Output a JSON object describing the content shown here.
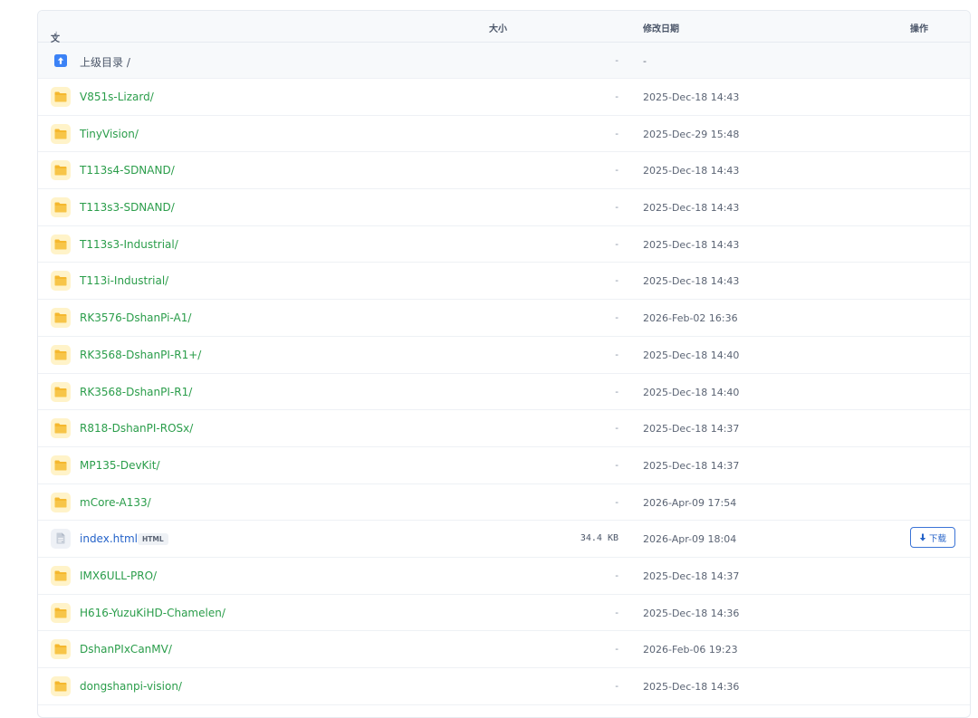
{
  "header": {
    "name": "文件名",
    "sort_icon": "↓",
    "size": "大小",
    "modified": "修改日期",
    "action": "操作"
  },
  "parent": {
    "label": "上级目录 /",
    "size": "-",
    "date": "-",
    "icon": "arrow-up-icon",
    "color": "#3b82f6"
  },
  "rows": [
    {
      "name": "V851s-Lizard/",
      "size": "-",
      "date": "2025-Dec-18 14:43",
      "type": "folder"
    },
    {
      "name": "TinyVision/",
      "size": "-",
      "date": "2025-Dec-29 15:48",
      "type": "folder"
    },
    {
      "name": "T113s4-SDNAND/",
      "size": "-",
      "date": "2025-Dec-18 14:43",
      "type": "folder"
    },
    {
      "name": "T113s3-SDNAND/",
      "size": "-",
      "date": "2025-Dec-18 14:43",
      "type": "folder"
    },
    {
      "name": "T113s3-Industrial/",
      "size": "-",
      "date": "2025-Dec-18 14:43",
      "type": "folder"
    },
    {
      "name": "T113i-Industrial/",
      "size": "-",
      "date": "2025-Dec-18 14:43",
      "type": "folder"
    },
    {
      "name": "RK3576-DshanPi-A1/",
      "size": "-",
      "date": "2026-Feb-02 16:36",
      "type": "folder"
    },
    {
      "name": "RK3568-DshanPI-R1+/",
      "size": "-",
      "date": "2025-Dec-18 14:40",
      "type": "folder"
    },
    {
      "name": "RK3568-DshanPI-R1/",
      "size": "-",
      "date": "2025-Dec-18 14:40",
      "type": "folder"
    },
    {
      "name": "R818-DshanPI-ROSx/",
      "size": "-",
      "date": "2025-Dec-18 14:37",
      "type": "folder"
    },
    {
      "name": "MP135-DevKit/",
      "size": "-",
      "date": "2025-Dec-18 14:37",
      "type": "folder"
    },
    {
      "name": "mCore-A133/",
      "size": "-",
      "date": "2026-Apr-09 17:54",
      "type": "folder"
    },
    {
      "name": "index.html",
      "badge": "HTML",
      "size": "34.4 KB",
      "date": "2026-Apr-09 18:04",
      "type": "file",
      "download_label": "下载"
    },
    {
      "name": "IMX6ULL-PRO/",
      "size": "-",
      "date": "2025-Dec-18 14:37",
      "type": "folder"
    },
    {
      "name": "H616-YuzuKiHD-Chamelen/",
      "size": "-",
      "date": "2025-Dec-18 14:36",
      "type": "folder"
    },
    {
      "name": "DshanPIxCanMV/",
      "size": "-",
      "date": "2026-Feb-06 19:23",
      "type": "folder"
    },
    {
      "name": "dongshanpi-vision/",
      "size": "-",
      "date": "2025-Dec-18 14:36",
      "type": "folder"
    }
  ],
  "colors": {
    "folder_link": "#2a9d4a",
    "file_link": "#2563c9",
    "folder_icon": "#f5b82e",
    "folder_icon_bg": "#fff3c9"
  }
}
